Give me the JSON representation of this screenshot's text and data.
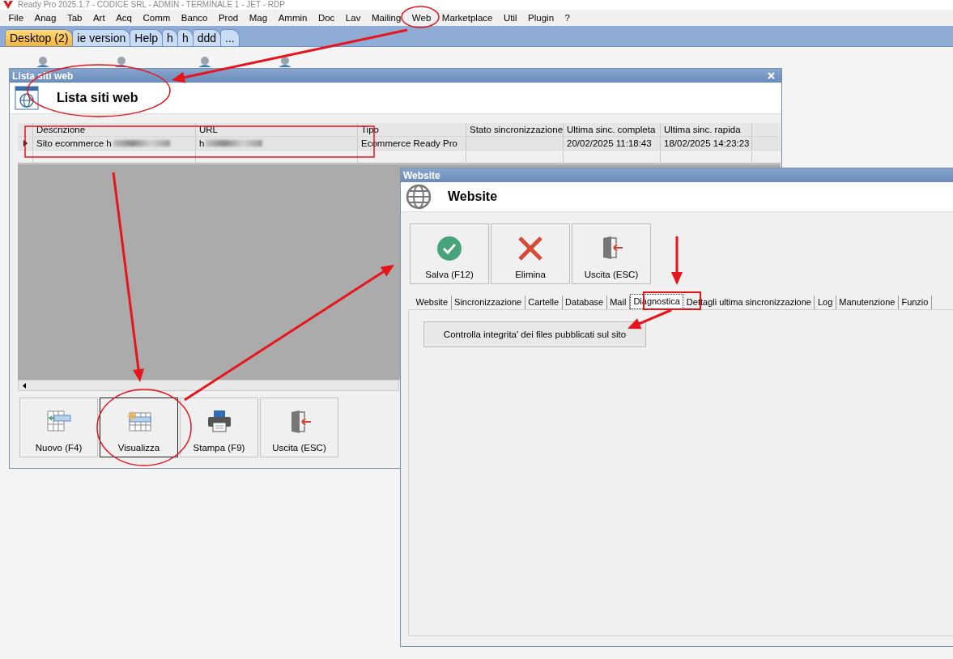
{
  "app_title": "Ready Pro 2025.1.7 - CODICE SRL - ADMIN - TERMINALE 1 - JET - RDP",
  "menu": [
    "File",
    "Anag",
    "Tab",
    "Art",
    "Acq",
    "Comm",
    "Banco",
    "Prod",
    "Mag",
    "Ammin",
    "Doc",
    "Lav",
    "Mailing",
    "Web",
    "Marketplace",
    "Util",
    "Plugin",
    "?"
  ],
  "tabs": [
    {
      "label": "Desktop (2)",
      "selected": true
    },
    {
      "label": "ie version",
      "selected": false
    },
    {
      "label": "Help",
      "selected": false
    },
    {
      "label": "h",
      "selected": false
    },
    {
      "label": "h",
      "selected": false
    },
    {
      "label": "ddd",
      "selected": false
    },
    {
      "label": "...",
      "selected": false
    }
  ],
  "list_window": {
    "title": "Lista siti web",
    "heading": "Lista siti web",
    "columns": [
      "Descrizione",
      "URL",
      "Tipo",
      "Stato sincronizzazione",
      "Ultima sinc. completa",
      "Ultima sinc. rapida"
    ],
    "rows": [
      {
        "selected": true,
        "cells": [
          {
            "text": "Sito ecommerce h",
            "redacted": true
          },
          {
            "text": "h",
            "redacted": true
          },
          {
            "text": "Ecommerce Ready Pro"
          },
          {
            "text": ""
          },
          {
            "text": "20/02/2025 11:18:43"
          },
          {
            "text": "18/02/2025 14:23:23"
          }
        ]
      }
    ],
    "buttons": [
      {
        "label": "Nuovo (F4)",
        "kind": "new",
        "focused": false
      },
      {
        "label": "Visualizza",
        "kind": "view",
        "focused": true
      },
      {
        "label": "Stampa (F9)",
        "kind": "print",
        "focused": false
      },
      {
        "label": "Uscita (ESC)",
        "kind": "exit",
        "focused": false
      }
    ]
  },
  "website_window": {
    "title": "Website",
    "heading": "Website",
    "buttons": [
      {
        "label": "Salva (F12)",
        "kind": "save"
      },
      {
        "label": "Elimina",
        "kind": "delete"
      },
      {
        "label": "Uscita (ESC)",
        "kind": "exit"
      }
    ],
    "tabs": [
      {
        "label": "Website",
        "selected": false
      },
      {
        "label": "Sincronizzazione",
        "selected": false
      },
      {
        "label": "Cartelle",
        "selected": false
      },
      {
        "label": "Database",
        "selected": false
      },
      {
        "label": "Mail",
        "selected": false
      },
      {
        "label": "Diagnostica",
        "selected": true
      },
      {
        "label": "Dettagli ultima sincronizzazione",
        "selected": false
      },
      {
        "label": "Log",
        "selected": false
      },
      {
        "label": "Manutenzione",
        "selected": false
      },
      {
        "label": "Funzio",
        "selected": false
      }
    ],
    "actions": [
      "Controlla integrita' dei files pubblicati sul sito"
    ]
  }
}
